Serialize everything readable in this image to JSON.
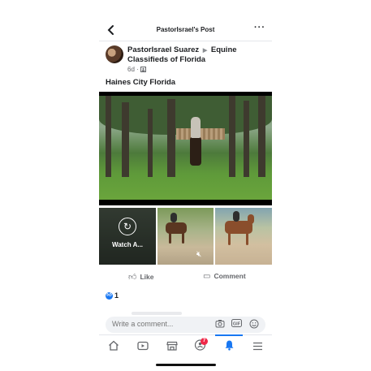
{
  "header": {
    "title": "PastorIsrael's Post",
    "back_icon": "chevron-left-icon",
    "more_label": "···"
  },
  "post": {
    "author": "PastorIsrael Suarez",
    "separator": "▶",
    "group": "Equine Classifieds of Florida",
    "time": "6d",
    "privacy_icon": "group-icon",
    "caption": "Haines City Florida"
  },
  "suggested": {
    "watch_label": "Watch A...",
    "replay_icon": "replay-icon",
    "mute_icon": "muted-speaker-icon"
  },
  "actions": {
    "like_label": "Like",
    "comment_label": "Comment"
  },
  "reactions": {
    "count": "1",
    "icon": "like-reaction-icon"
  },
  "comment_bar": {
    "placeholder": "Write a comment...",
    "icons": [
      "camera-icon",
      "gif-icon",
      "emoji-icon"
    ]
  },
  "nav": {
    "items": [
      "home-icon",
      "video-icon",
      "marketplace-icon",
      "groups-icon",
      "notifications-icon",
      "menu-icon"
    ],
    "groups_badge": "7",
    "active": "notifications-icon"
  },
  "colors": {
    "accent": "#1877f2",
    "badge": "#f02849",
    "muted_text": "#65676b"
  }
}
